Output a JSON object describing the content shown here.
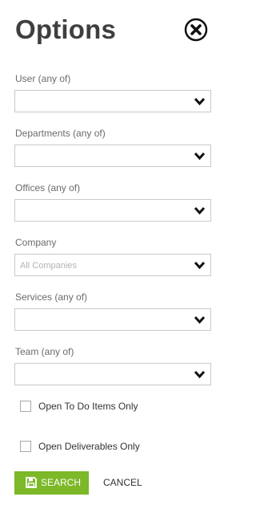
{
  "panel": {
    "title": "Options"
  },
  "filters": [
    {
      "label": "User (any of)",
      "value": ""
    },
    {
      "label": "Departments (any of)",
      "value": ""
    },
    {
      "label": "Offices (any of)",
      "value": ""
    },
    {
      "label": "Company",
      "value": "All Companies"
    },
    {
      "label": "Services (any of)",
      "value": ""
    },
    {
      "label": "Team (any of)",
      "value": ""
    }
  ],
  "checkboxes": [
    {
      "label": "Open To Do Items Only",
      "checked": false
    },
    {
      "label": "Open Deliverables Only",
      "checked": false
    }
  ],
  "actions": {
    "search_label": "SEARCH",
    "cancel_label": "CANCEL"
  },
  "icons": {
    "close": "close-circle-icon",
    "dropdown": "chevron-down-icon",
    "search": "save-icon"
  },
  "colors": {
    "accent": "#7cb828",
    "title": "#3f3f3f"
  }
}
